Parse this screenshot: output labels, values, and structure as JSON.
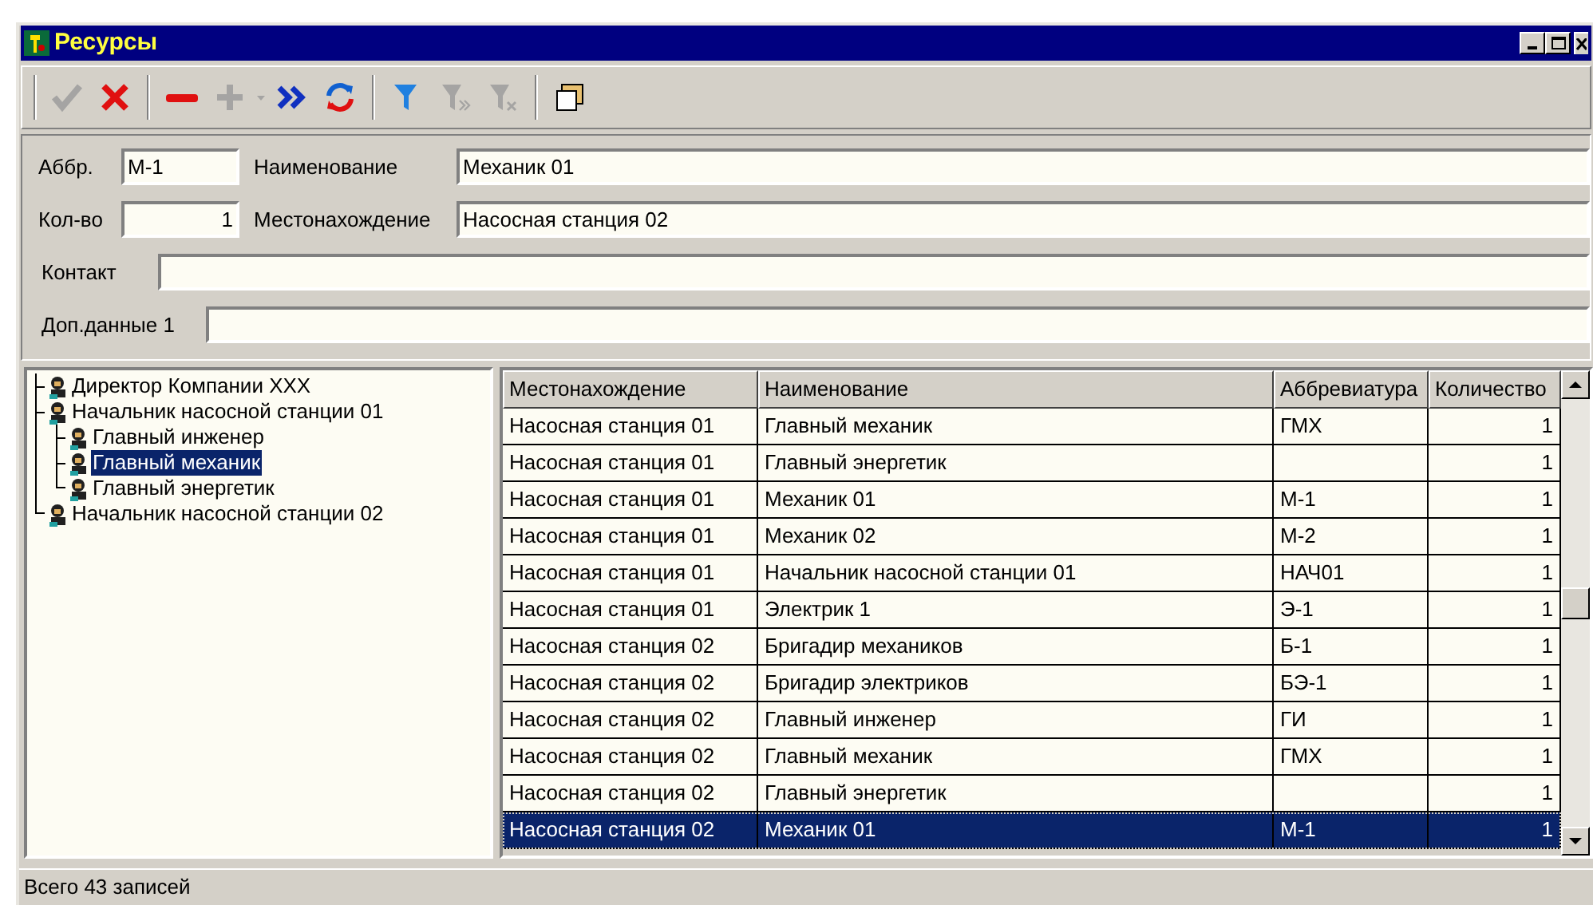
{
  "window": {
    "title": "Ресурсы"
  },
  "toolbar": [
    {
      "kind": "check",
      "disabled": true
    },
    {
      "kind": "cancel",
      "disabled": false
    },
    {
      "kind": "separator"
    },
    {
      "kind": "remove",
      "disabled": false
    },
    {
      "kind": "add",
      "disabled": true
    },
    {
      "kind": "dropdown",
      "disabled": true
    },
    {
      "kind": "forward",
      "disabled": false
    },
    {
      "kind": "refresh",
      "disabled": false
    },
    {
      "kind": "separator"
    },
    {
      "kind": "filter",
      "disabled": false
    },
    {
      "kind": "filter-next",
      "disabled": true
    },
    {
      "kind": "filter-clear",
      "disabled": true
    },
    {
      "kind": "separator"
    },
    {
      "kind": "window",
      "disabled": false
    }
  ],
  "form": {
    "abbr": {
      "label": "Аббр.",
      "value": "М-1"
    },
    "name": {
      "label": "Наименование",
      "value": "Механик 01"
    },
    "count": {
      "label": "Кол-во",
      "value": "1"
    },
    "location": {
      "label": "Местонахождение",
      "value": "Насосная станция 02"
    },
    "contact": {
      "label": "Контакт"
    },
    "extra": {
      "label": "Доп.данные 1"
    }
  },
  "tree": [
    {
      "label": "Директор Компании XXX",
      "selected": false
    },
    {
      "label": "Начальник насосной станции 01",
      "selected": false,
      "children": [
        {
          "label": "Главный инженер",
          "selected": false
        },
        {
          "label": "Главный механик",
          "selected": true
        },
        {
          "label": "Главный энергетик",
          "selected": false
        }
      ]
    },
    {
      "label": "Начальник насосной станции 02",
      "selected": false
    }
  ],
  "table": {
    "columns": [
      "Местонахождение",
      "Наименование",
      "Аббревиатура",
      "Количество"
    ],
    "rows": [
      {
        "cells": [
          "Насосная станция 01",
          "Главный механик",
          "ГМХ",
          "1"
        ],
        "selected": false
      },
      {
        "cells": [
          "Насосная станция 01",
          "Главный энергетик",
          "",
          "1"
        ],
        "selected": false
      },
      {
        "cells": [
          "Насосная станция 01",
          "Механик 01",
          "М-1",
          "1"
        ],
        "selected": false
      },
      {
        "cells": [
          "Насосная станция 01",
          "Механик 02",
          "М-2",
          "1"
        ],
        "selected": false
      },
      {
        "cells": [
          "Насосная станция 01",
          "Начальник насосной станции 01",
          "НАЧ01",
          "1"
        ],
        "selected": false
      },
      {
        "cells": [
          "Насосная станция 01",
          "Электрик 1",
          "Э-1",
          "1"
        ],
        "selected": false
      },
      {
        "cells": [
          "Насосная станция 02",
          "Бригадир механиков",
          "Б-1",
          "1"
        ],
        "selected": false
      },
      {
        "cells": [
          "Насосная станция 02",
          "Бригадир электриков",
          "БЭ-1",
          "1"
        ],
        "selected": false
      },
      {
        "cells": [
          "Насосная станция 02",
          "Главный инженер",
          "ГИ",
          "1"
        ],
        "selected": false
      },
      {
        "cells": [
          "Насосная станция 02",
          "Главный механик",
          "ГМХ",
          "1"
        ],
        "selected": false
      },
      {
        "cells": [
          "Насосная станция 02",
          "Главный энергетик",
          "",
          "1"
        ],
        "selected": false
      },
      {
        "cells": [
          "Насосная станция 02",
          "Механик 01",
          "М-1",
          "1"
        ],
        "selected": true
      }
    ]
  },
  "status_bar": "Всего 43 записей"
}
